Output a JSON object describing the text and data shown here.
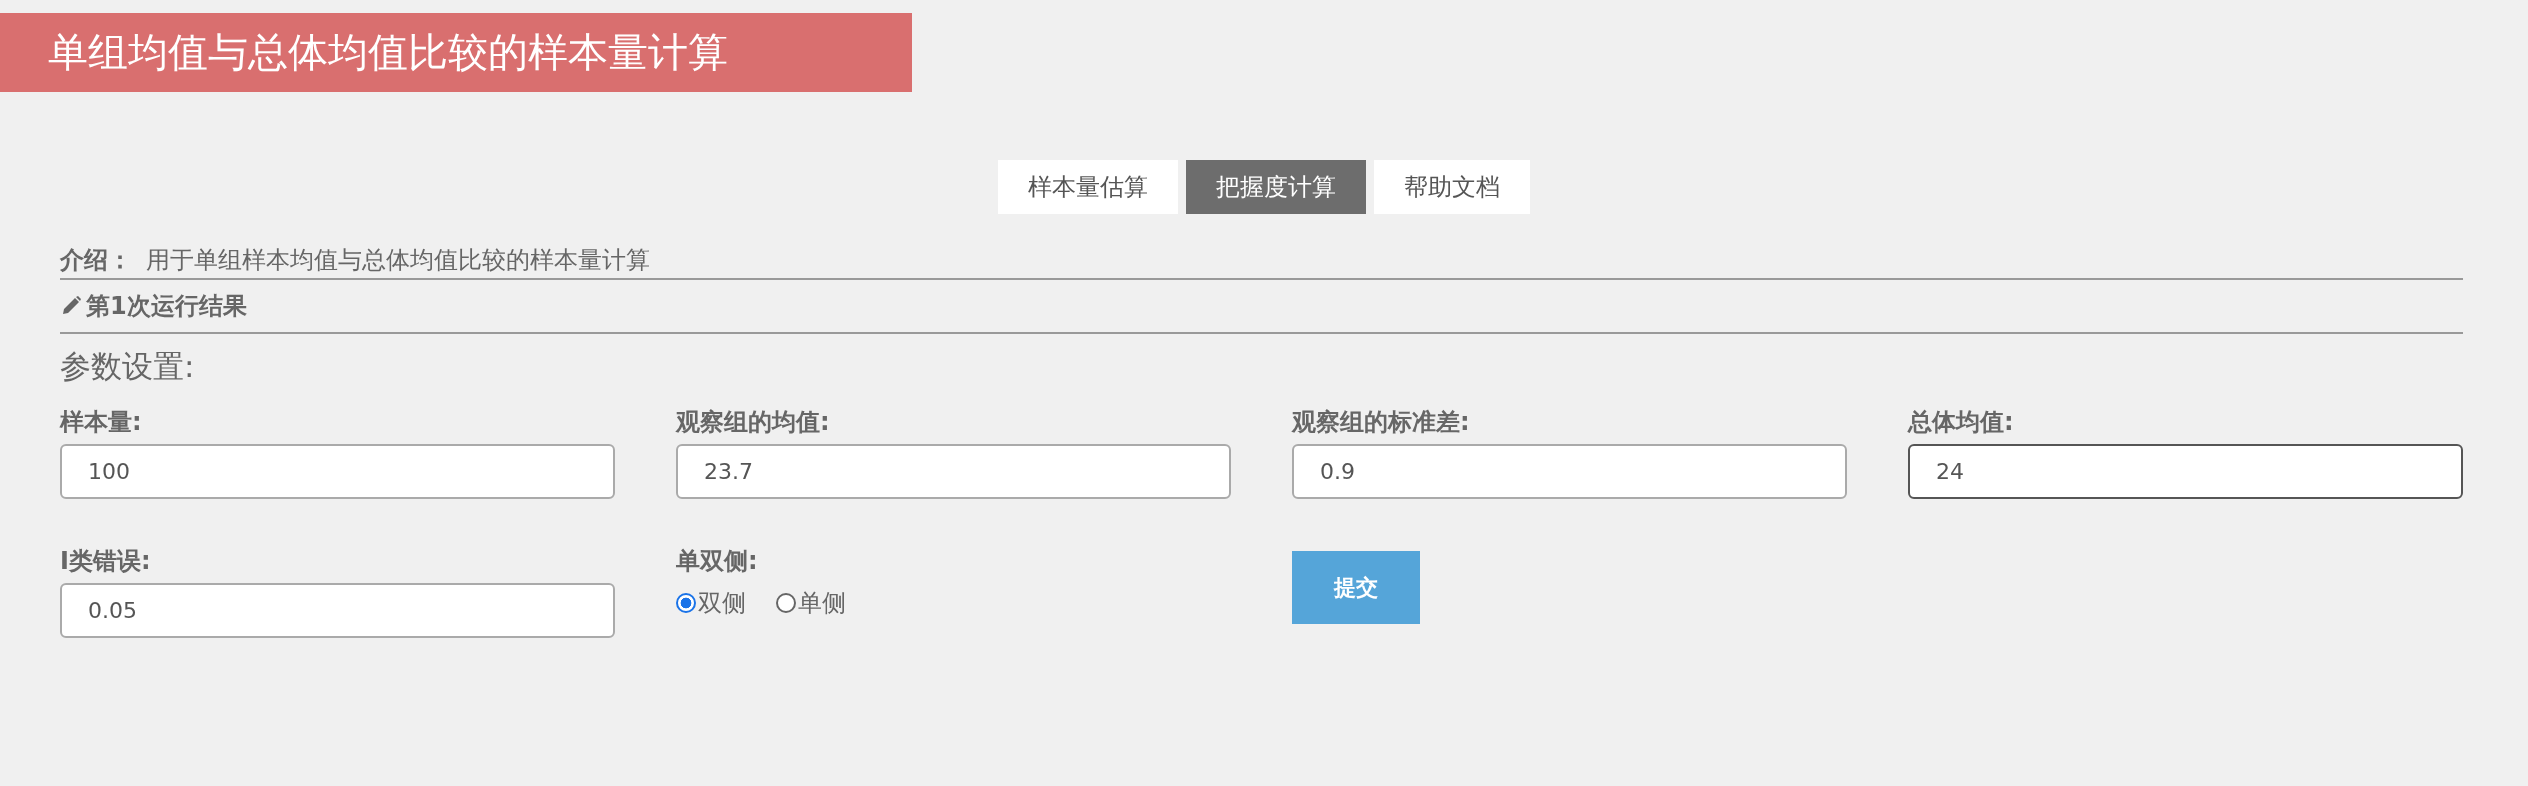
{
  "header": {
    "title": "单组均值与总体均值比较的样本量计算"
  },
  "tabs": [
    {
      "label": "样本量估算",
      "selected": false
    },
    {
      "label": "把握度计算",
      "selected": true
    },
    {
      "label": "帮助文档",
      "selected": false
    }
  ],
  "intro": {
    "label": "介绍：",
    "text": "用于单组样本均值与总体均值比较的样本量计算"
  },
  "result_header": {
    "title": "第1次运行结果"
  },
  "params": {
    "title": "参数设置:",
    "items": [
      {
        "kind": "input",
        "label": "样本量:",
        "value": "100",
        "focused": false
      },
      {
        "kind": "input",
        "label": "观察组的均值:",
        "value": "23.7",
        "focused": false
      },
      {
        "kind": "input",
        "label": "观察组的标准差:",
        "value": "0.9",
        "focused": false
      },
      {
        "kind": "input",
        "label": "总体均值:",
        "value": "24",
        "focused": true
      },
      {
        "kind": "input",
        "label": "Ⅰ类错误:",
        "value": "0.05",
        "focused": false
      },
      {
        "kind": "radio",
        "label": "单双侧:",
        "options": [
          {
            "label": "双侧",
            "selected": true
          },
          {
            "label": "单侧",
            "selected": false
          }
        ]
      },
      {
        "kind": "submit",
        "label": "提交"
      }
    ]
  }
}
